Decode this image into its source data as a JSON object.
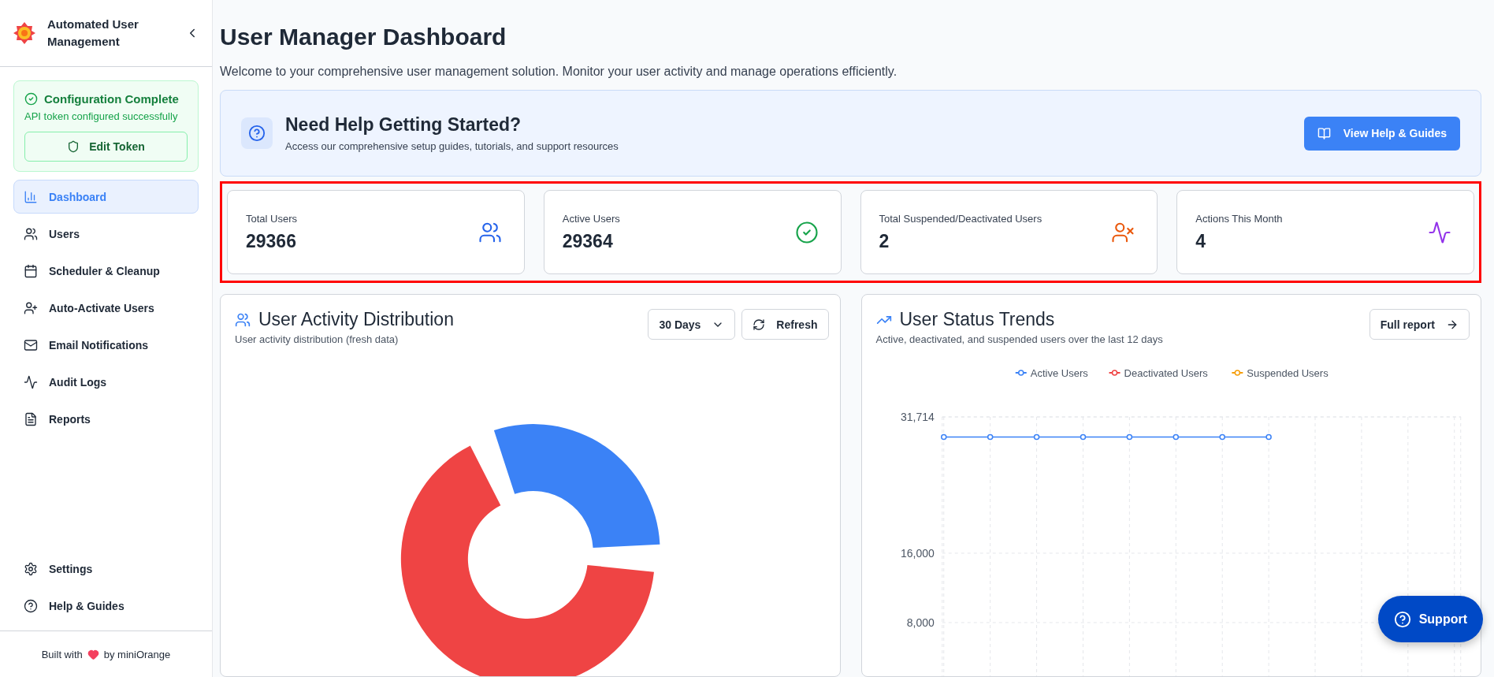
{
  "sidebar": {
    "brand_title": "Automated User Management",
    "config": {
      "title": "Configuration Complete",
      "message": "API token configured successfully",
      "button": "Edit Token"
    },
    "nav": [
      {
        "label": "Dashboard",
        "selected": true
      },
      {
        "label": "Users",
        "selected": false
      },
      {
        "label": "Scheduler & Cleanup",
        "selected": false
      },
      {
        "label": "Auto-Activate Users",
        "selected": false
      },
      {
        "label": "Email Notifications",
        "selected": false
      },
      {
        "label": "Audit Logs",
        "selected": false
      },
      {
        "label": "Reports",
        "selected": false
      }
    ],
    "bottom_nav": [
      {
        "label": "Settings",
        "selected": false
      },
      {
        "label": "Help & Guides",
        "selected": false
      }
    ],
    "footer": {
      "before": "Built with",
      "after": "by miniOrange"
    }
  },
  "header": {
    "title": "User Manager Dashboard",
    "subtitle": "Welcome to your comprehensive user management solution. Monitor your user activity and manage operations efficiently."
  },
  "help_banner": {
    "title": "Need Help Getting Started?",
    "text": "Access our comprehensive setup guides, tutorials, and support resources",
    "button": "View Help & Guides"
  },
  "stats": [
    {
      "label": "Total Users",
      "value": "29366",
      "color": "#2563eb"
    },
    {
      "label": "Active Users",
      "value": "29364",
      "color": "#16a34a"
    },
    {
      "label": "Total Suspended/Deactivated Users",
      "value": "2",
      "color": "#ea580c"
    },
    {
      "label": "Actions This Month",
      "value": "4",
      "color": "#9333ea"
    }
  ],
  "activity_card": {
    "title": "User Activity Distribution",
    "subtitle": "User activity distribution (fresh data)",
    "range": "30 Days",
    "refresh": "Refresh"
  },
  "trends_card": {
    "title": "User Status Trends",
    "subtitle": "Active, deactivated, and suspended users over the last 12 days",
    "button": "Full report",
    "chart_data": {
      "type": "line",
      "grid": true,
      "legend": true,
      "ylim": [
        0,
        31714
      ],
      "yticks": [
        {
          "value": 8000,
          "label": "8,000"
        },
        {
          "value": 16000,
          "label": "16,000"
        },
        {
          "value": 31714,
          "label": "31,714"
        }
      ],
      "series": [
        {
          "name": "Active Users",
          "color": "#3b82f6",
          "marker": "circle",
          "values": [
            29400,
            29400,
            29400,
            29400,
            29400,
            29400,
            29400,
            29400,
            null,
            null,
            null,
            null
          ]
        },
        {
          "name": "Deactivated Users",
          "color": "#ef4444",
          "marker": "circle",
          "values": [
            null,
            null,
            null,
            null,
            null,
            null,
            null,
            null,
            null,
            null,
            null,
            null
          ]
        },
        {
          "name": "Suspended Users",
          "color": "#f59e0b",
          "marker": "circle",
          "values": [
            null,
            null,
            null,
            null,
            null,
            null,
            null,
            null,
            null,
            null,
            null,
            null
          ]
        }
      ]
    }
  },
  "support_button": "Support"
}
